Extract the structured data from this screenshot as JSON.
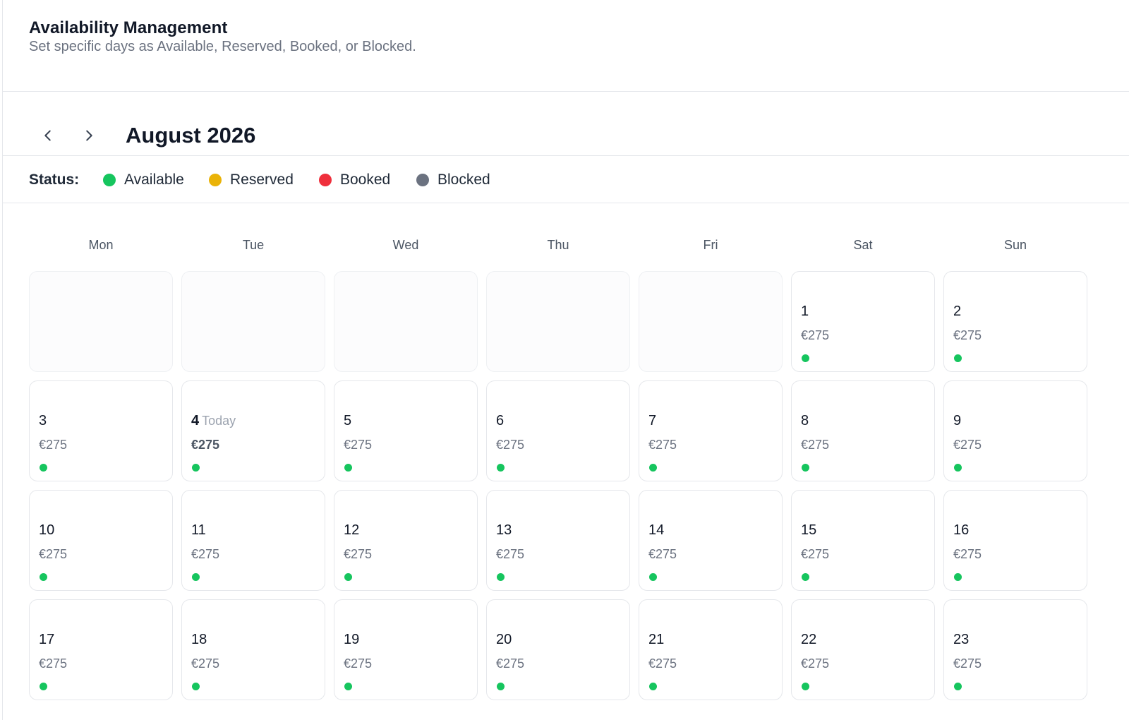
{
  "header": {
    "title": "Availability Management",
    "subtitle": "Set specific days as Available, Reserved, Booked, or Blocked."
  },
  "calendar": {
    "month_label": "August 2026",
    "prev_icon": "chevron-left-icon",
    "next_icon": "chevron-right-icon"
  },
  "legend": {
    "label": "Status:",
    "items": [
      {
        "label": "Available",
        "color": "#16c55e"
      },
      {
        "label": "Reserved",
        "color": "#eab308"
      },
      {
        "label": "Booked",
        "color": "#ef2f3c"
      },
      {
        "label": "Blocked",
        "color": "#6b7280"
      }
    ]
  },
  "weekdays": [
    "Mon",
    "Tue",
    "Wed",
    "Thu",
    "Fri",
    "Sat",
    "Sun"
  ],
  "today_label": "Today",
  "days": [
    {
      "day": "",
      "empty": true
    },
    {
      "day": "",
      "empty": true
    },
    {
      "day": "",
      "empty": true
    },
    {
      "day": "",
      "empty": true
    },
    {
      "day": "",
      "empty": true
    },
    {
      "day": "1",
      "price": "€275",
      "status": "Available"
    },
    {
      "day": "2",
      "price": "€275",
      "status": "Available"
    },
    {
      "day": "3",
      "price": "€275",
      "status": "Available"
    },
    {
      "day": "4",
      "price": "€275",
      "status": "Available",
      "today": true
    },
    {
      "day": "5",
      "price": "€275",
      "status": "Available"
    },
    {
      "day": "6",
      "price": "€275",
      "status": "Available"
    },
    {
      "day": "7",
      "price": "€275",
      "status": "Available"
    },
    {
      "day": "8",
      "price": "€275",
      "status": "Available"
    },
    {
      "day": "9",
      "price": "€275",
      "status": "Available"
    },
    {
      "day": "10",
      "price": "€275",
      "status": "Available"
    },
    {
      "day": "11",
      "price": "€275",
      "status": "Available"
    },
    {
      "day": "12",
      "price": "€275",
      "status": "Available"
    },
    {
      "day": "13",
      "price": "€275",
      "status": "Available"
    },
    {
      "day": "14",
      "price": "€275",
      "status": "Available"
    },
    {
      "day": "15",
      "price": "€275",
      "status": "Available"
    },
    {
      "day": "16",
      "price": "€275",
      "status": "Available"
    },
    {
      "day": "17",
      "price": "€275",
      "status": "Available"
    },
    {
      "day": "18",
      "price": "€275",
      "status": "Available"
    },
    {
      "day": "19",
      "price": "€275",
      "status": "Available"
    },
    {
      "day": "20",
      "price": "€275",
      "status": "Available"
    },
    {
      "day": "21",
      "price": "€275",
      "status": "Available"
    },
    {
      "day": "22",
      "price": "€275",
      "status": "Available"
    },
    {
      "day": "23",
      "price": "€275",
      "status": "Available"
    }
  ]
}
